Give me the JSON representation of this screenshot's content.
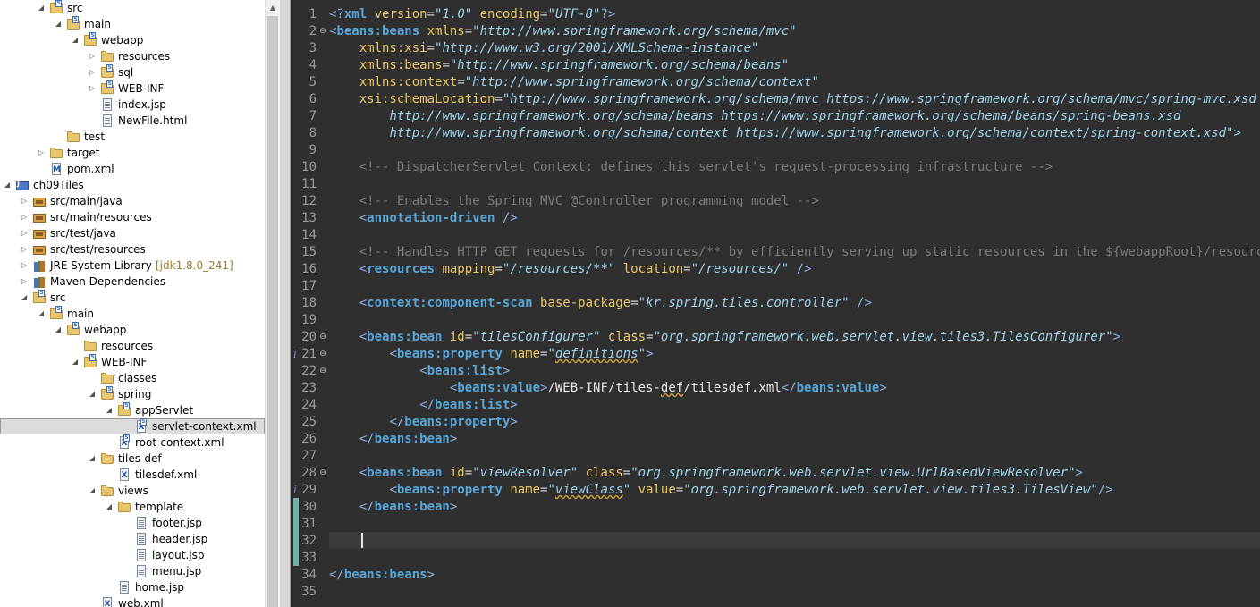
{
  "tree": {
    "rows": [
      {
        "label": "src",
        "icon": "folder",
        "overlay": "S",
        "arrow": "expanded",
        "depth": 2
      },
      {
        "label": "main",
        "icon": "folder",
        "overlay": "S",
        "arrow": "expanded",
        "depth": 3
      },
      {
        "label": "webapp",
        "icon": "folder",
        "overlay": "S",
        "arrow": "expanded",
        "depth": 4
      },
      {
        "label": "resources",
        "icon": "folder",
        "overlay": "",
        "arrow": "collapsed",
        "depth": 5
      },
      {
        "label": "sql",
        "icon": "folder",
        "overlay": "S",
        "arrow": "collapsed",
        "depth": 5
      },
      {
        "label": "WEB-INF",
        "icon": "folder",
        "overlay": "S",
        "arrow": "collapsed",
        "depth": 5
      },
      {
        "label": "index.jsp",
        "icon": "file",
        "overlay": "",
        "arrow": "none",
        "depth": 5
      },
      {
        "label": "NewFile.html",
        "icon": "file",
        "overlay": "",
        "arrow": "none",
        "depth": 5
      },
      {
        "label": "test",
        "icon": "folder",
        "overlay": "",
        "arrow": "none",
        "depth": 3
      },
      {
        "label": "target",
        "icon": "folder",
        "overlay": "",
        "arrow": "collapsed",
        "depth": 2
      },
      {
        "label": "pom.xml",
        "icon": "maven",
        "overlay": "",
        "arrow": "none",
        "depth": 2
      },
      {
        "label": "ch09Tiles",
        "icon": "project",
        "overlay": "",
        "arrow": "expanded",
        "depth": 0
      },
      {
        "label": "src/main/java",
        "icon": "pkg",
        "overlay": "",
        "arrow": "collapsed",
        "depth": 1
      },
      {
        "label": "src/main/resources",
        "icon": "pkg",
        "overlay": "",
        "arrow": "collapsed",
        "depth": 1
      },
      {
        "label": "src/test/java",
        "icon": "pkg",
        "overlay": "",
        "arrow": "collapsed",
        "depth": 1
      },
      {
        "label": "src/test/resources",
        "icon": "pkg",
        "overlay": "",
        "arrow": "collapsed",
        "depth": 1
      },
      {
        "label": "JRE System Library",
        "decoration": "[jdk1.8.0_241]",
        "icon": "lib",
        "overlay": "",
        "arrow": "collapsed",
        "depth": 1
      },
      {
        "label": "Maven Dependencies",
        "icon": "lib",
        "overlay": "",
        "arrow": "collapsed",
        "depth": 1
      },
      {
        "label": "src",
        "icon": "folder",
        "overlay": "S",
        "arrow": "expanded",
        "depth": 1
      },
      {
        "label": "main",
        "icon": "folder",
        "overlay": "S",
        "arrow": "expanded",
        "depth": 2
      },
      {
        "label": "webapp",
        "icon": "folder",
        "overlay": "S",
        "arrow": "expanded",
        "depth": 3
      },
      {
        "label": "resources",
        "icon": "folder",
        "overlay": "",
        "arrow": "none",
        "depth": 4
      },
      {
        "label": "WEB-INF",
        "icon": "folder",
        "overlay": "S",
        "arrow": "expanded",
        "depth": 4
      },
      {
        "label": "classes",
        "icon": "folder",
        "overlay": "",
        "arrow": "none",
        "depth": 5
      },
      {
        "label": "spring",
        "icon": "folder",
        "overlay": "S",
        "arrow": "expanded",
        "depth": 5
      },
      {
        "label": "appServlet",
        "icon": "folder",
        "overlay": "S",
        "arrow": "expanded",
        "depth": 6
      },
      {
        "label": "servlet-context.xml",
        "icon": "xml",
        "overlay": "S",
        "arrow": "none",
        "depth": 7,
        "selected": true
      },
      {
        "label": "root-context.xml",
        "icon": "xml",
        "overlay": "S",
        "arrow": "none",
        "depth": 6
      },
      {
        "label": "tiles-def",
        "icon": "folder",
        "overlay": "",
        "arrow": "expanded",
        "depth": 5
      },
      {
        "label": "tilesdef.xml",
        "icon": "xml",
        "overlay": "",
        "arrow": "none",
        "depth": 6
      },
      {
        "label": "views",
        "icon": "folder",
        "overlay": "",
        "arrow": "expanded",
        "depth": 5
      },
      {
        "label": "template",
        "icon": "folder",
        "overlay": "",
        "arrow": "expanded",
        "depth": 6
      },
      {
        "label": "footer.jsp",
        "icon": "file",
        "overlay": "",
        "arrow": "none",
        "depth": 7
      },
      {
        "label": "header.jsp",
        "icon": "file",
        "overlay": "",
        "arrow": "none",
        "depth": 7
      },
      {
        "label": "layout.jsp",
        "icon": "file",
        "overlay": "",
        "arrow": "none",
        "depth": 7
      },
      {
        "label": "menu.jsp",
        "icon": "file",
        "overlay": "",
        "arrow": "none",
        "depth": 7
      },
      {
        "label": "home.jsp",
        "icon": "file",
        "overlay": "",
        "arrow": "none",
        "depth": 6
      },
      {
        "label": "web.xml",
        "icon": "xml",
        "overlay": "",
        "arrow": "none",
        "depth": 5
      }
    ]
  },
  "editor": {
    "current_line": 32,
    "info_lines": [
      21,
      29
    ],
    "changed_lines": [
      30,
      31,
      32,
      33
    ],
    "fold_lines": [
      2,
      20,
      21,
      22,
      28
    ],
    "underlined_linenums": [
      16
    ],
    "lines": [
      {
        "n": "1",
        "tokens": [
          [
            "pi",
            "<?"
          ],
          [
            "tag",
            "xml"
          ],
          [
            "attr",
            " version"
          ],
          [
            "eq",
            "="
          ],
          [
            "val",
            "\"1.0\""
          ],
          [
            "attr",
            " encoding"
          ],
          [
            "eq",
            "="
          ],
          [
            "val",
            "\"UTF-8\""
          ],
          [
            "pi",
            "?>"
          ]
        ]
      },
      {
        "n": "2",
        "tokens": [
          [
            "br",
            "<"
          ],
          [
            "tag",
            "beans:beans"
          ],
          [
            "attr",
            " xmlns"
          ],
          [
            "eq",
            "="
          ],
          [
            "val",
            "\"http://www.springframework.org/schema/mvc\""
          ]
        ]
      },
      {
        "n": "3",
        "tokens": [
          [
            "txt",
            "    "
          ],
          [
            "attr",
            "xmlns:xsi"
          ],
          [
            "eq",
            "="
          ],
          [
            "val",
            "\"http://www.w3.org/2001/XMLSchema-instance\""
          ]
        ]
      },
      {
        "n": "4",
        "tokens": [
          [
            "txt",
            "    "
          ],
          [
            "attr",
            "xmlns:beans"
          ],
          [
            "eq",
            "="
          ],
          [
            "val",
            "\"http://www.springframework.org/schema/beans\""
          ]
        ]
      },
      {
        "n": "5",
        "tokens": [
          [
            "txt",
            "    "
          ],
          [
            "attr",
            "xmlns:context"
          ],
          [
            "eq",
            "="
          ],
          [
            "val",
            "\"http://www.springframework.org/schema/context\""
          ]
        ]
      },
      {
        "n": "6",
        "tokens": [
          [
            "txt",
            "    "
          ],
          [
            "attr",
            "xsi:schemaLocation"
          ],
          [
            "eq",
            "="
          ],
          [
            "val",
            "\"http://www.springframework.org/schema/mvc https://www.springframework.org/schema/mvc/spring-mvc.xsd"
          ]
        ]
      },
      {
        "n": "7",
        "tokens": [
          [
            "txt",
            "        "
          ],
          [
            "val",
            "http://www.springframework.org/schema/beans https://www.springframework.org/schema/beans/spring-beans.xsd"
          ]
        ]
      },
      {
        "n": "8",
        "tokens": [
          [
            "txt",
            "        "
          ],
          [
            "val",
            "http://www.springframework.org/schema/context https://www.springframework.org/schema/context/spring-context.xsd\">"
          ]
        ]
      },
      {
        "n": "9",
        "tokens": []
      },
      {
        "n": "10",
        "tokens": [
          [
            "txt",
            "    "
          ],
          [
            "cmt",
            "<!-- DispatcherServlet Context: defines this servlet's request-processing infrastructure -->"
          ]
        ]
      },
      {
        "n": "11",
        "tokens": []
      },
      {
        "n": "12",
        "tokens": [
          [
            "txt",
            "    "
          ],
          [
            "cmt",
            "<!-- Enables the Spring MVC @Controller programming model -->"
          ]
        ]
      },
      {
        "n": "13",
        "tokens": [
          [
            "txt",
            "    "
          ],
          [
            "br",
            "<"
          ],
          [
            "tag",
            "annotation-driven"
          ],
          [
            "br",
            " />"
          ]
        ]
      },
      {
        "n": "14",
        "tokens": []
      },
      {
        "n": "15",
        "tokens": [
          [
            "txt",
            "    "
          ],
          [
            "cmt",
            "<!-- Handles HTTP GET requests for /resources/** by efficiently serving up static resources in the ${webappRoot}/resources directory -->"
          ]
        ]
      },
      {
        "n": "16",
        "tokens": [
          [
            "txt",
            "    "
          ],
          [
            "br",
            "<"
          ],
          [
            "tag",
            "resources"
          ],
          [
            "attr",
            " mapping"
          ],
          [
            "eq",
            "="
          ],
          [
            "val",
            "\"/resources/**\""
          ],
          [
            "attr",
            " location"
          ],
          [
            "eq",
            "="
          ],
          [
            "val",
            "\"/resources/\""
          ],
          [
            "br",
            " />"
          ]
        ]
      },
      {
        "n": "17",
        "tokens": []
      },
      {
        "n": "18",
        "tokens": [
          [
            "txt",
            "    "
          ],
          [
            "br",
            "<"
          ],
          [
            "tag",
            "context:component-scan"
          ],
          [
            "attr",
            " base-package"
          ],
          [
            "eq",
            "="
          ],
          [
            "val",
            "\"kr.spring.tiles.controller\""
          ],
          [
            "br",
            " />"
          ]
        ]
      },
      {
        "n": "19",
        "tokens": []
      },
      {
        "n": "20",
        "tokens": [
          [
            "txt",
            "    "
          ],
          [
            "br",
            "<"
          ],
          [
            "tag",
            "beans:bean"
          ],
          [
            "attr",
            " id"
          ],
          [
            "eq",
            "="
          ],
          [
            "val",
            "\"tilesConfigurer\""
          ],
          [
            "attr",
            " class"
          ],
          [
            "eq",
            "="
          ],
          [
            "val",
            "\"org.springframework.web.servlet.view.tiles3.TilesConfigurer\""
          ],
          [
            "br",
            ">"
          ]
        ]
      },
      {
        "n": "21",
        "tokens": [
          [
            "txt",
            "        "
          ],
          [
            "br",
            "<"
          ],
          [
            "tag",
            "beans:property"
          ],
          [
            "attr",
            " name"
          ],
          [
            "eq",
            "="
          ],
          [
            "val",
            "\""
          ],
          [
            "valsq",
            "definitions"
          ],
          [
            "val",
            "\""
          ],
          [
            "br",
            ">"
          ]
        ]
      },
      {
        "n": "22",
        "tokens": [
          [
            "txt",
            "            "
          ],
          [
            "br",
            "<"
          ],
          [
            "tag",
            "beans:list"
          ],
          [
            "br",
            ">"
          ]
        ]
      },
      {
        "n": "23",
        "tokens": [
          [
            "txt",
            "                "
          ],
          [
            "br",
            "<"
          ],
          [
            "tag",
            "beans:value"
          ],
          [
            "br",
            ">"
          ],
          [
            "txt",
            "/WEB-INF/tiles-"
          ],
          [
            "txtsq",
            "def"
          ],
          [
            "txt",
            "/tilesdef.xml"
          ],
          [
            "br",
            "</"
          ],
          [
            "tag",
            "beans:value"
          ],
          [
            "br",
            ">"
          ]
        ]
      },
      {
        "n": "24",
        "tokens": [
          [
            "txt",
            "            "
          ],
          [
            "br",
            "</"
          ],
          [
            "tag",
            "beans:list"
          ],
          [
            "br",
            ">"
          ]
        ]
      },
      {
        "n": "25",
        "tokens": [
          [
            "txt",
            "        "
          ],
          [
            "br",
            "</"
          ],
          [
            "tag",
            "beans:property"
          ],
          [
            "br",
            ">"
          ]
        ]
      },
      {
        "n": "26",
        "tokens": [
          [
            "txt",
            "    "
          ],
          [
            "br",
            "</"
          ],
          [
            "tag",
            "beans:bean"
          ],
          [
            "br",
            ">"
          ]
        ]
      },
      {
        "n": "27",
        "tokens": []
      },
      {
        "n": "28",
        "tokens": [
          [
            "txt",
            "    "
          ],
          [
            "br",
            "<"
          ],
          [
            "tag",
            "beans:bean"
          ],
          [
            "attr",
            " id"
          ],
          [
            "eq",
            "="
          ],
          [
            "val",
            "\"viewResolver\""
          ],
          [
            "attr",
            " class"
          ],
          [
            "eq",
            "="
          ],
          [
            "val",
            "\"org.springframework.web.servlet.view.UrlBasedViewResolver\""
          ],
          [
            "br",
            ">"
          ]
        ]
      },
      {
        "n": "29",
        "tokens": [
          [
            "txt",
            "        "
          ],
          [
            "br",
            "<"
          ],
          [
            "tag",
            "beans:property"
          ],
          [
            "attr",
            " name"
          ],
          [
            "eq",
            "="
          ],
          [
            "val",
            "\""
          ],
          [
            "valsq",
            "viewClass"
          ],
          [
            "val",
            "\""
          ],
          [
            "attr",
            " value"
          ],
          [
            "eq",
            "="
          ],
          [
            "val",
            "\"org.springframework.web.servlet.view.tiles3.TilesView\""
          ],
          [
            "br",
            "/>"
          ]
        ]
      },
      {
        "n": "30",
        "tokens": [
          [
            "txt",
            "    "
          ],
          [
            "br",
            "</"
          ],
          [
            "tag",
            "beans:bean"
          ],
          [
            "br",
            ">"
          ]
        ]
      },
      {
        "n": "31",
        "tokens": []
      },
      {
        "n": "32",
        "tokens": []
      },
      {
        "n": "33",
        "tokens": []
      },
      {
        "n": "34",
        "tokens": [
          [
            "br",
            "</"
          ],
          [
            "tag",
            "beans:beans"
          ],
          [
            "br",
            ">"
          ]
        ]
      },
      {
        "n": "35",
        "tokens": []
      }
    ]
  }
}
